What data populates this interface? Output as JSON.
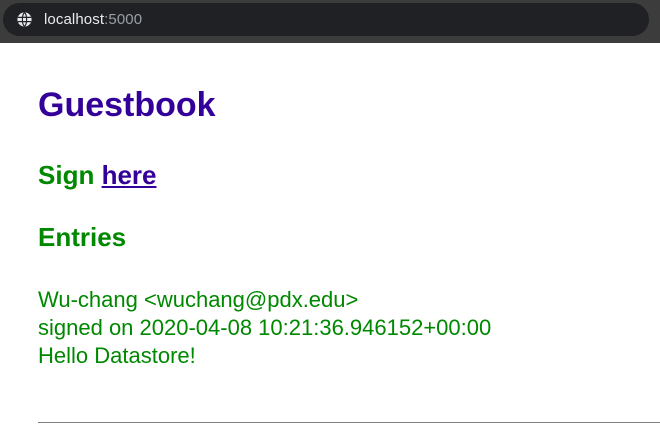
{
  "browser": {
    "url_host": "localhost",
    "url_port": ":5000",
    "icon": "globe-icon"
  },
  "page": {
    "title": "Guestbook",
    "sign_prefix": "Sign",
    "sign_link": "here",
    "entries_heading": "Entries",
    "entries": [
      {
        "author": "Wu-chang <wuchang@pdx.edu>",
        "signed": "signed on 2020-04-08 10:21:36.946152+00:00",
        "message": "Hello Datastore!"
      }
    ]
  },
  "colors": {
    "title": "#330099",
    "heading": "#008800",
    "link": "#330099",
    "entry_text": "#008800"
  }
}
